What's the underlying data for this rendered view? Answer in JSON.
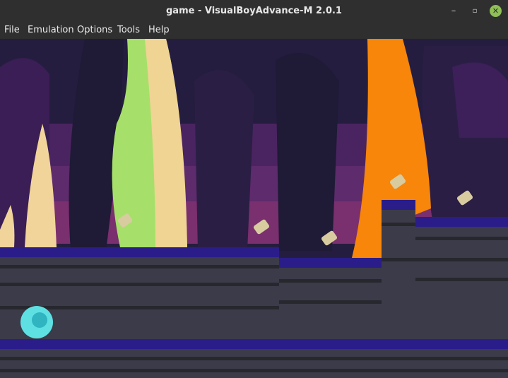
{
  "window": {
    "title": "game - VisualBoyAdvance-M 2.0.1"
  },
  "window_controls": {
    "minimize_glyph": "–",
    "maximize_glyph": "▫",
    "close_glyph": "✕"
  },
  "menu": {
    "items": [
      "File",
      "Emulation",
      "Options",
      "Tools",
      "Help"
    ]
  },
  "colors": {
    "titlebar": "#2f2f2f",
    "close_button": "#8fbf57",
    "sky_dark": "#2a2247",
    "sky_purple": "#5a2a6e",
    "ground_top": "#2a1d8a",
    "ground_fill": "#3c3b4a",
    "ground_stripe": "#27272e",
    "tree_orange": "#f7860a",
    "tree_green": "#a6e06a",
    "player": "#5ee0e3",
    "coin": "#d8cba0"
  },
  "game": {
    "coins_visible": 5,
    "player": "cyan blob"
  }
}
